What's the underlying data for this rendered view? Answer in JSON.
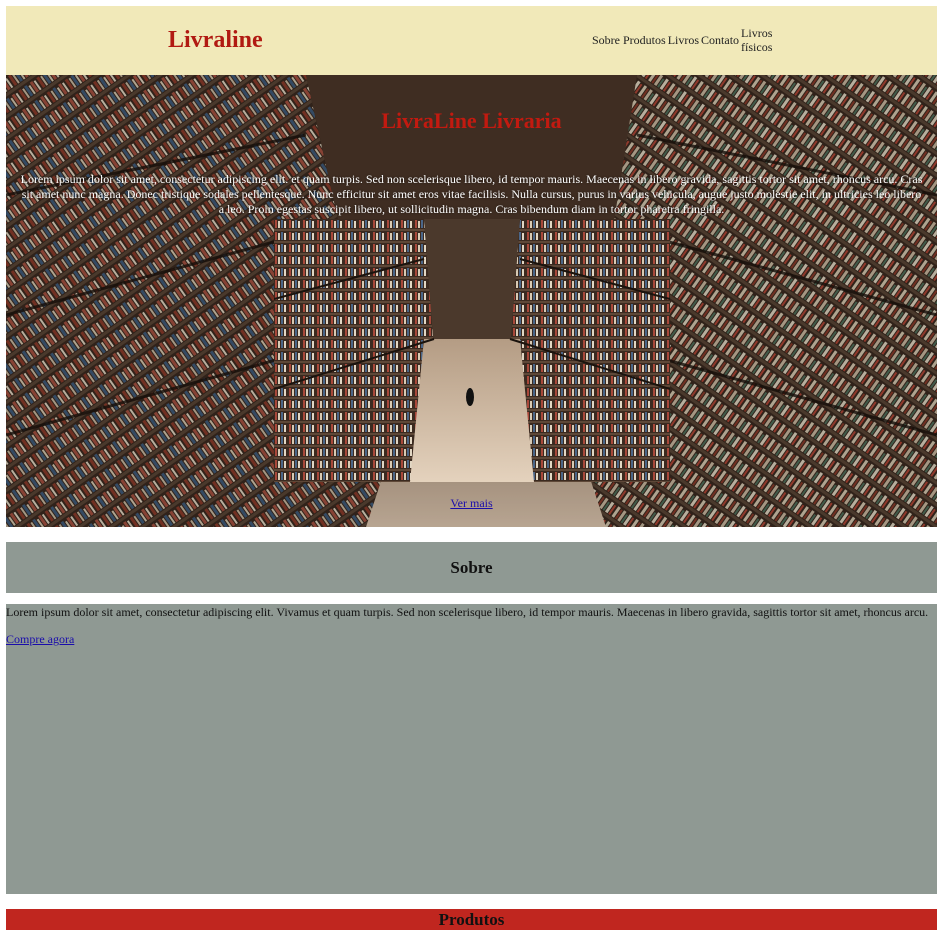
{
  "header": {
    "logo": "Livraline",
    "nav": [
      "Sobre",
      "Produtos",
      "Livros",
      "Contato",
      "Livros físicos"
    ]
  },
  "hero": {
    "title": "LivraLine Livraria",
    "text": "Lorem ipsum dolor sit amet, consectetur adipiscing elit. et quam turpis. Sed non scelerisque libero, id tempor mauris. Maecenas in libero gravida, sagittis tortor sit amet, rhoncus arcu. Cras sit amet nunc magna. Donec tristique sodales pellentesque. Nunc efficitur sit amet eros vitae facilisis. Nulla cursus, purus in varius vehicula, augue justo molestie elit, in ultricies leo libero a leo. Proin egestas suscipit libero, ut sollicitudin magna. Cras bibendum diam in tortor pharetra fringilla.",
    "link": "Ver mais"
  },
  "sobre": {
    "title": "Sobre",
    "text": "Lorem ipsum dolor sit amet, consectetur adipiscing elit. Vivamus et quam turpis. Sed non scelerisque libero, id tempor mauris. Maecenas in libero gravida, sagittis tortor sit amet, rhoncus arcu.",
    "link": "Compre agora"
  },
  "produtos": {
    "title": "Produtos"
  },
  "colors": {
    "header_bg": "#f1e9b9",
    "logo": "#b11a12",
    "hero_title": "#c21a10",
    "sobre_bg": "#8f9993",
    "produtos_bg": "#c0261f",
    "link": "#1a0dab"
  }
}
